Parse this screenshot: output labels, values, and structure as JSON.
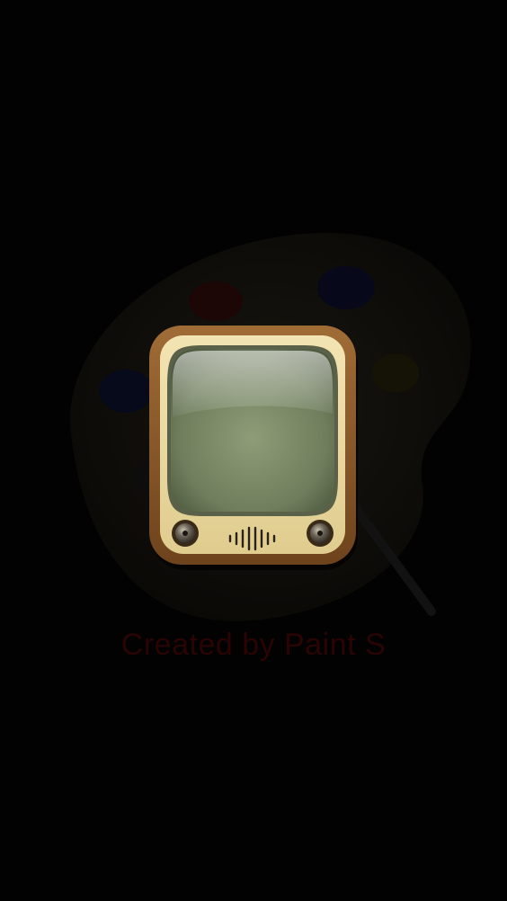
{
  "splash": {
    "watermark_text": "Created by Paint S",
    "app_icon": "youtube-tv-icon",
    "background_graphic": "palette-icon"
  },
  "colors": {
    "background": "#020202",
    "tv_frame": "#8a5a2a",
    "tv_bezel": "#e9d8a0",
    "tv_screen": "#7f8e6c",
    "watermark_text": "#2a0404"
  }
}
